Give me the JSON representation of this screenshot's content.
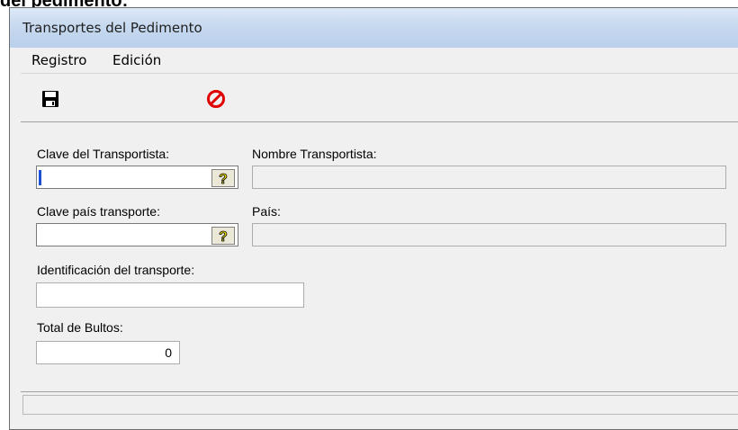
{
  "background_heading": "del pedimento:",
  "window": {
    "title": "Transportes del Pedimento"
  },
  "menu": {
    "items": [
      {
        "label": "Registro"
      },
      {
        "label": "Edición"
      }
    ]
  },
  "toolbar": {
    "save_icon": "floppy-disk-icon",
    "cancel_icon": "no-entry-icon",
    "accent_color": "#e00000"
  },
  "form": {
    "clave_transportista": {
      "label": "Clave del Transportista:",
      "value": ""
    },
    "nombre_transportista": {
      "label": "Nombre Transportista:",
      "value": ""
    },
    "clave_pais": {
      "label": "Clave país transporte:",
      "value": ""
    },
    "pais": {
      "label": "País:",
      "value": ""
    },
    "identificacion": {
      "label": "Identificación del transporte:",
      "value": ""
    },
    "total_bultos": {
      "label": "Total de Bultos:",
      "value": "0"
    },
    "help_glyph": "?"
  },
  "statusbar": {
    "text": ""
  }
}
